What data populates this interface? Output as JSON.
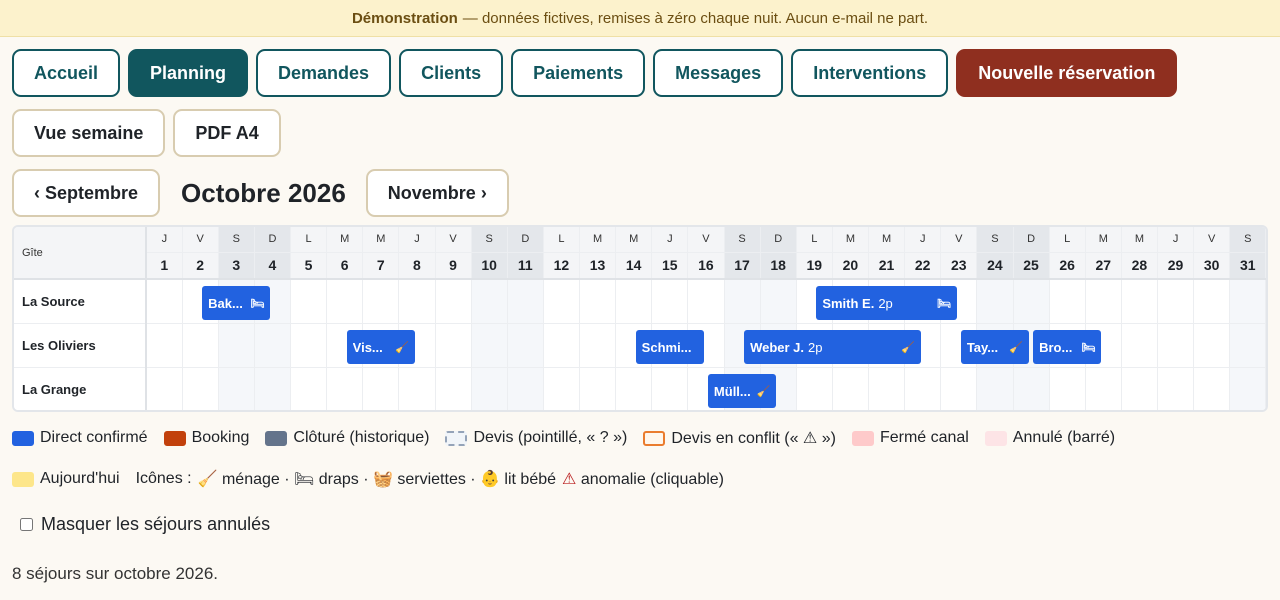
{
  "banner": {
    "bold": "Démonstration",
    "text": "— données fictives, remises à zéro chaque nuit. Aucun e-mail ne part."
  },
  "nav": [
    {
      "label": "Accueil",
      "name": "nav-accueil",
      "state": ""
    },
    {
      "label": "Planning",
      "name": "nav-planning",
      "state": "active"
    },
    {
      "label": "Demandes",
      "name": "nav-demandes",
      "state": ""
    },
    {
      "label": "Clients",
      "name": "nav-clients",
      "state": ""
    },
    {
      "label": "Paiements",
      "name": "nav-paiements",
      "state": ""
    },
    {
      "label": "Messages",
      "name": "nav-messages",
      "state": ""
    },
    {
      "label": "Interventions",
      "name": "nav-interventions",
      "state": ""
    },
    {
      "label": "Nouvelle réservation",
      "name": "new-reservation-button",
      "state": "primary"
    }
  ],
  "views": {
    "week": "Vue semaine",
    "pdf": "PDF A4"
  },
  "month": {
    "prev": "‹ Septembre",
    "title": "Octobre 2026",
    "next": "Novembre ›"
  },
  "grid": {
    "gite_header": "Gîte",
    "day_letters": [
      "J",
      "V",
      "S",
      "D",
      "L",
      "M",
      "M",
      "J",
      "V",
      "S",
      "D",
      "L",
      "M",
      "M",
      "J",
      "V",
      "S",
      "D",
      "L",
      "M",
      "M",
      "J",
      "V",
      "S",
      "D",
      "L",
      "M",
      "M",
      "J",
      "V",
      "S"
    ],
    "weekend_days": [
      3,
      4,
      10,
      11,
      17,
      18,
      24,
      25,
      31
    ],
    "gites": [
      "La Source",
      "Les Oliviers",
      "La Grange"
    ]
  },
  "stays": [
    {
      "gite": 0,
      "start": 2,
      "end": 3,
      "label": "Bak...",
      "extra": "",
      "icon": "🛏",
      "icon_name": "bed-icon"
    },
    {
      "gite": 0,
      "start": 19,
      "end": 22,
      "label": "Smith E.",
      "extra": "2p",
      "icon": "🛏",
      "icon_name": "bed-icon"
    },
    {
      "gite": 1,
      "start": 6,
      "end": 7,
      "label": "Vis...",
      "extra": "",
      "icon": "🧹",
      "icon_name": "broom-icon"
    },
    {
      "gite": 1,
      "start": 14,
      "end": 15,
      "label": "Schmi...",
      "extra": "",
      "icon": "",
      "icon_name": ""
    },
    {
      "gite": 1,
      "start": 17,
      "end": 21,
      "label": "Weber J.",
      "extra": "2p",
      "icon": "🧹",
      "icon_name": "broom-icon"
    },
    {
      "gite": 1,
      "start": 23,
      "end": 24,
      "label": "Tay...",
      "extra": "",
      "icon": "🧹",
      "icon_name": "broom-icon"
    },
    {
      "gite": 1,
      "start": 25,
      "end": 26,
      "label": "Bro...",
      "extra": "",
      "icon": "🛏",
      "icon_name": "bed-icon"
    },
    {
      "gite": 2,
      "start": 16,
      "end": 17,
      "label": "Müll...",
      "extra": "",
      "icon": "🧹",
      "icon_name": "broom-icon"
    }
  ],
  "legend": {
    "items": [
      {
        "label": "Direct confirmé",
        "color": "#2262e0",
        "border": "#2262e0",
        "style": "solid"
      },
      {
        "label": "Booking",
        "color": "#c2410c",
        "border": "#c2410c",
        "style": "solid"
      },
      {
        "label": "Clôturé (historique)",
        "color": "#64748b",
        "border": "#64748b",
        "style": "solid"
      },
      {
        "label": "Devis (pointillé, « ? »)",
        "color": "#f1f5f9",
        "border": "#94a3b8",
        "style": "dashed"
      },
      {
        "label": "Devis en conflit (« ⚠ »)",
        "color": "#fff7ed",
        "border": "#ea7c2e",
        "style": "solid"
      },
      {
        "label": "Fermé canal",
        "color": "#fecaca",
        "border": "#fecaca",
        "style": "solid"
      },
      {
        "label": "Annulé (barré)",
        "color": "#fde4e6",
        "border": "#fde4e6",
        "style": "solid"
      }
    ],
    "today": {
      "label": "Aujourd'hui",
      "color": "#fde68a"
    },
    "icons_prefix": "Icônes :",
    "icons_text": "🧹 ménage · 🛏 draps · 🧺 serviettes · 👶 lit bébé",
    "anomaly_icon": "⚠",
    "anomaly_text": "anomalie (cliquable)",
    "anomaly_color": "#b91c1c"
  },
  "hide_cancelled": {
    "label": "Masquer les séjours annulés",
    "checked": false
  },
  "summary": "8 séjours sur octobre 2026.",
  "colors": {
    "accent": "#11565e",
    "primary": "#8f2f1f",
    "stay_blue": "#2262e0"
  }
}
